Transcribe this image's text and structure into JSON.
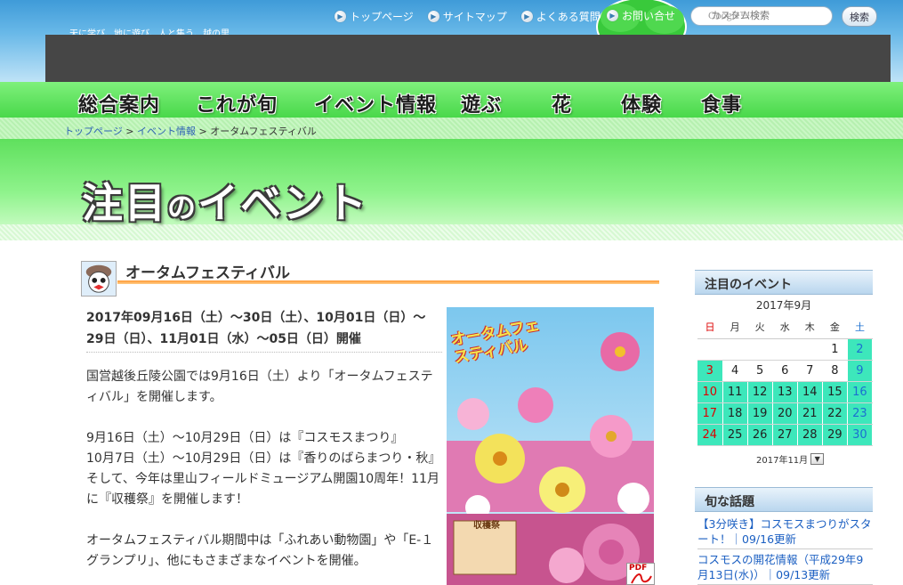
{
  "header": {
    "tagline": "天に学び、地に遊び、人と集う、越の里",
    "links": [
      {
        "label": "トップページ"
      },
      {
        "label": "サイトマップ"
      },
      {
        "label": "よくある質問"
      }
    ],
    "contact_label": "お問い合せ",
    "search": {
      "logo_text": "Google™",
      "placeholder": "カスタム検索",
      "button_label": "検索"
    }
  },
  "nav": {
    "items": [
      "総合案内",
      "これが旬",
      "イベント情報",
      "遊ぶ",
      "花",
      "体験",
      "食事"
    ]
  },
  "breadcrumb": {
    "items": [
      "トップページ",
      "イベント情報"
    ],
    "separator": ">",
    "current": "オータムフェスティバル"
  },
  "page_title": {
    "main": "注目",
    "particle": "の",
    "rest": "イベント"
  },
  "article": {
    "title": "オータムフェスティバル",
    "dates": "2017年09月16日（土）～30日（土）、10月01日（日）～29日（日）、11月01日（水）～05日（日）開催",
    "paragraphs": [
      "国営越後丘陵公園では9月16日（土）より「オータムフェスティバル」を開催します。",
      "9月16日（土）～10月29日（日）は『コスモスまつり』\n10月7日（土）～10月29日（日）は『香りのばらまつり・秋』\nそして、今年は里山フィールドミュージアム開園10周年！11月に『収穫祭』を開催します！",
      "オータムフェスティバル期間中は「ふれあい動物園」や「E-１グランプリ」、他にもさまざまなイベントを開催。"
    ],
    "poster": {
      "title": "オータムフェスティバル",
      "sub_label": "収穫祭"
    },
    "pdf_label": "PDF"
  },
  "sidebar": {
    "calendar_heading": "注目のイベント",
    "month_label": "2017年9月",
    "weekdays": [
      "日",
      "月",
      "火",
      "水",
      "木",
      "金",
      "土"
    ],
    "weeks": [
      [
        "",
        "",
        "",
        "",
        "",
        "1",
        "2"
      ],
      [
        "3",
        "4",
        "5",
        "6",
        "7",
        "8",
        "9"
      ],
      [
        "10",
        "11",
        "12",
        "13",
        "14",
        "15",
        "16"
      ],
      [
        "17",
        "18",
        "19",
        "20",
        "21",
        "22",
        "23"
      ],
      [
        "24",
        "25",
        "26",
        "27",
        "28",
        "29",
        "30"
      ]
    ],
    "event_days": [
      "2",
      "3",
      "9",
      "10",
      "11",
      "12",
      "13",
      "14",
      "15",
      "16",
      "17",
      "18",
      "19",
      "20",
      "21",
      "22",
      "23",
      "24",
      "25",
      "26",
      "27",
      "28",
      "29",
      "30"
    ],
    "month_select": "2017年11月",
    "topics_heading": "旬な話題",
    "topics": [
      "【3分咲き】コスモスまつりがスタート！｜09/16更新",
      "コスモスの開花情報（平成29年9月13日(水)）｜09/13更新"
    ]
  },
  "colors": {
    "sky": "#3f9bd8",
    "nav_green": "#49d84a",
    "event_day": "#3de7bb",
    "accent_orange": "#ff9933",
    "link_blue": "#1b5fc2"
  }
}
